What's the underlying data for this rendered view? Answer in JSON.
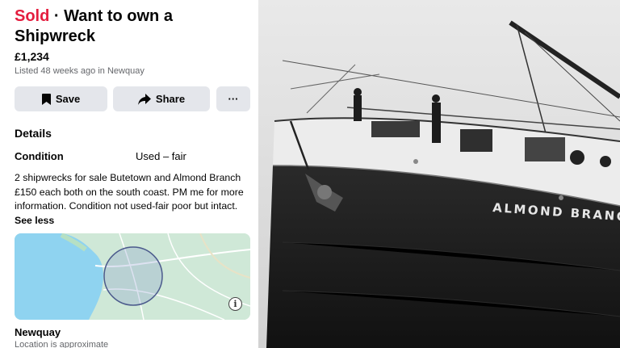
{
  "listing": {
    "status": "Sold",
    "separator": "·",
    "title": "Want to own a Shipwreck",
    "price": "£1,234",
    "listed": "Listed 48 weeks ago in Newquay"
  },
  "actions": {
    "save_label": "Save",
    "share_label": "Share",
    "more_label": "···"
  },
  "details": {
    "heading": "Details",
    "condition_label": "Condition",
    "condition_value": "Used – fair",
    "description": "2 shipwrecks for sale Butetown and Almond Branch £150 each both on the south coast. PM me for more information. Condition not used-fair poor but intact. ",
    "see_less": "See less"
  },
  "map": {
    "info_glyph": "i"
  },
  "location": {
    "name": "Newquay",
    "note": "Location is approximate"
  },
  "photo": {
    "ship_name": "ALMOND BRANCH"
  },
  "colors": {
    "sold": "#e41e3f",
    "button_bg": "#e4e6eb",
    "muted_text": "#65676b",
    "sea": "#8fd3f0",
    "land": "#cfe8d7"
  },
  "icons": [
    "bookmark-icon",
    "share-arrow-icon",
    "more-dots-icon",
    "info-icon"
  ]
}
